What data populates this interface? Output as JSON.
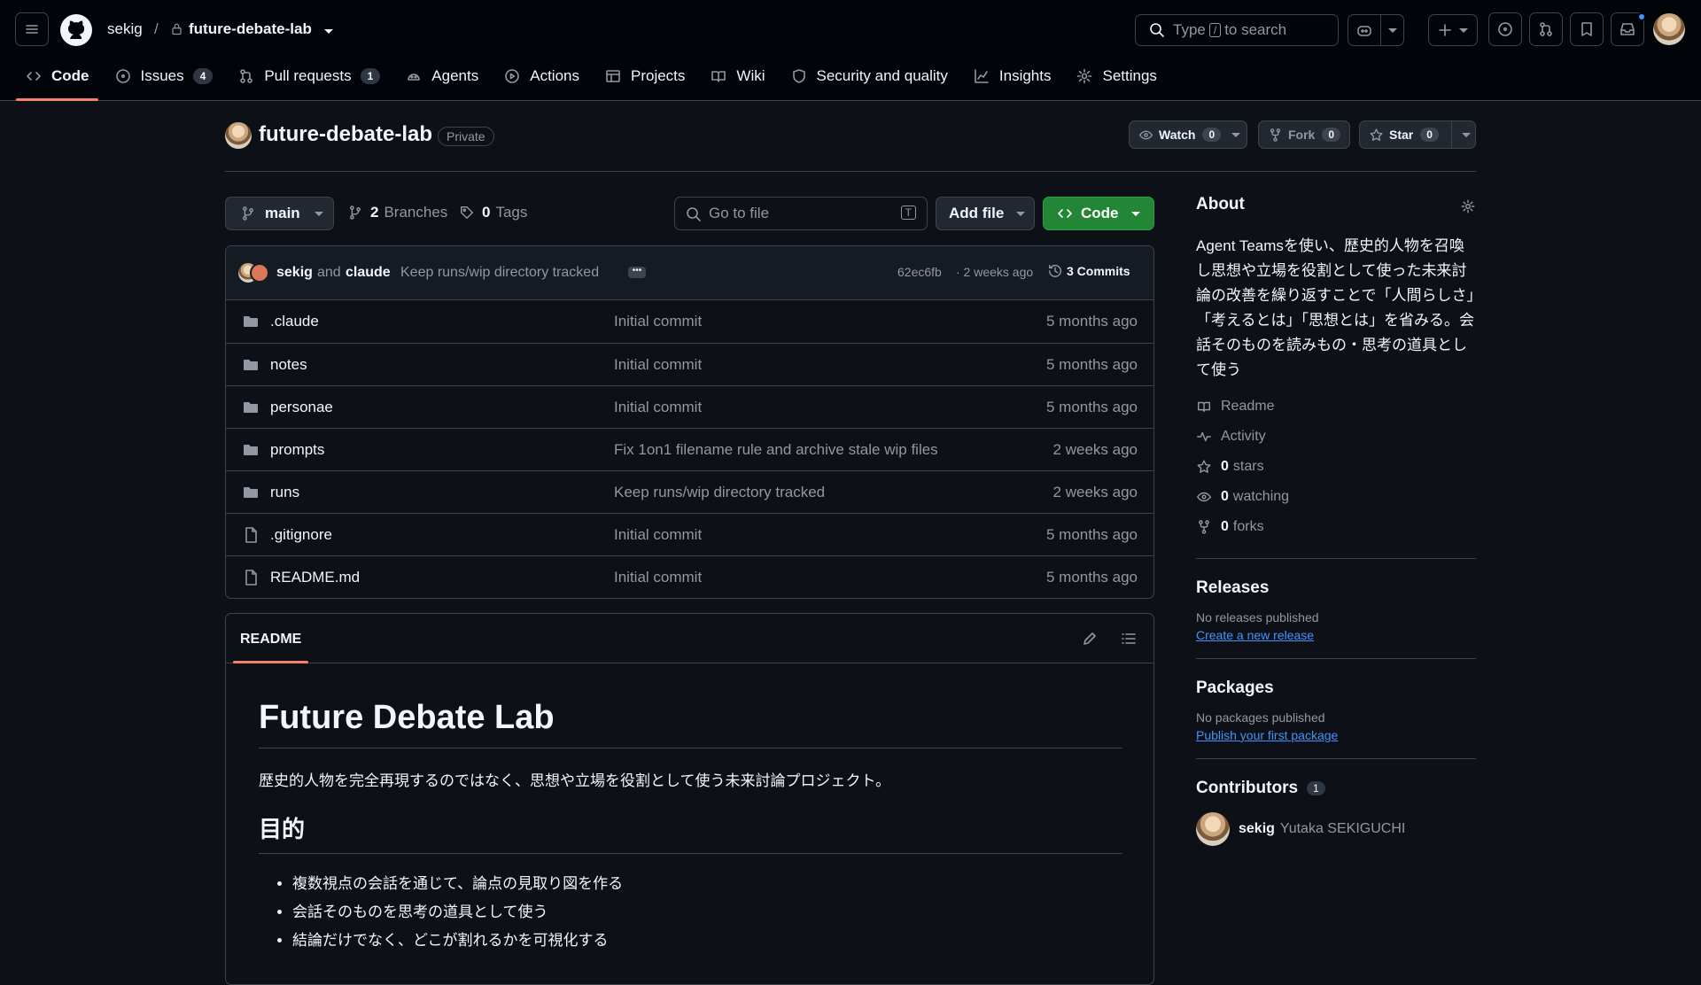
{
  "header": {
    "owner": "sekig",
    "separator": "/",
    "repo": "future-debate-lab",
    "search_prefix": "Type",
    "search_key": "/",
    "search_suffix": "to search"
  },
  "tabs": [
    {
      "label": "Code",
      "icon": "code-icon",
      "active": true
    },
    {
      "label": "Issues",
      "icon": "issue-icon",
      "count": "4"
    },
    {
      "label": "Pull requests",
      "icon": "pull-request-icon",
      "count": "1"
    },
    {
      "label": "Agents",
      "icon": "agents-icon"
    },
    {
      "label": "Actions",
      "icon": "play-icon"
    },
    {
      "label": "Projects",
      "icon": "table-icon"
    },
    {
      "label": "Wiki",
      "icon": "book-icon"
    },
    {
      "label": "Security and quality",
      "icon": "shield-icon"
    },
    {
      "label": "Insights",
      "icon": "graph-icon"
    },
    {
      "label": "Settings",
      "icon": "gear-icon"
    }
  ],
  "repo_header": {
    "name": "future-debate-lab",
    "visibility": "Private",
    "watch_label": "Watch",
    "watch_count": "0",
    "fork_label": "Fork",
    "fork_count": "0",
    "star_label": "Star",
    "star_count": "0"
  },
  "toolbar": {
    "branch": "main",
    "branches_count": "2",
    "branches_label": "Branches",
    "tags_count": "0",
    "tags_label": "Tags",
    "goto_placeholder": "Go to file",
    "goto_key": "T",
    "add_file": "Add file",
    "code": "Code"
  },
  "commit": {
    "author1": "sekig",
    "and": "and",
    "author2": "claude",
    "message": "Keep runs/wip directory tracked",
    "sha": "62ec6fb",
    "time": "· 2 weeks ago",
    "commits": "3 Commits"
  },
  "files": [
    {
      "type": "dir",
      "name": ".claude",
      "message": "Initial commit",
      "date": "5 months ago"
    },
    {
      "type": "dir",
      "name": "notes",
      "message": "Initial commit",
      "date": "5 months ago"
    },
    {
      "type": "dir",
      "name": "personae",
      "message": "Initial commit",
      "date": "5 months ago"
    },
    {
      "type": "dir",
      "name": "prompts",
      "message": "Fix 1on1 filename rule and archive stale wip files",
      "date": "2 weeks ago"
    },
    {
      "type": "dir",
      "name": "runs",
      "message": "Keep runs/wip directory tracked",
      "date": "2 weeks ago"
    },
    {
      "type": "file",
      "name": ".gitignore",
      "message": "Initial commit",
      "date": "5 months ago"
    },
    {
      "type": "file",
      "name": "README.md",
      "message": "Initial commit",
      "date": "5 months ago"
    }
  ],
  "readme": {
    "tab": "README",
    "h1": "Future Debate Lab",
    "intro": "歴史的人物を完全再現するのではなく、思想や立場を役割として使う未来討論プロジェクト。",
    "h2": "目的",
    "bullets": [
      "複数視点の会話を通じて、論点の見取り図を作る",
      "会話そのものを思考の道具として使う",
      "結論だけでなく、どこが割れるかを可視化する"
    ]
  },
  "about": {
    "title": "About",
    "description": "Agent Teamsを使い、歴史的人物を召喚し思想や立場を役割として使った未来討論の改善を繰り返すことで「人間らしさ」「考えるとは」「思想とは」を省みる。会話そのものを読みもの・思考の道具として使う",
    "readme": "Readme",
    "activity": "Activity",
    "stars_count": "0",
    "stars_label": "stars",
    "watching_count": "0",
    "watching_label": "watching",
    "forks_count": "0",
    "forks_label": "forks"
  },
  "releases": {
    "title": "Releases",
    "empty": "No releases published",
    "link": "Create a new release"
  },
  "packages": {
    "title": "Packages",
    "empty": "No packages published",
    "link": "Publish your first package"
  },
  "contributors": {
    "title": "Contributors",
    "count": "1",
    "login": "sekig",
    "fullname": "Yutaka SEKIGUCHI"
  },
  "colors": {
    "background": "#0d1117",
    "header": "#010409",
    "border": "#3d444d",
    "accent_tab": "#f78166",
    "code_button": "#238636",
    "link": "#4493f8"
  }
}
